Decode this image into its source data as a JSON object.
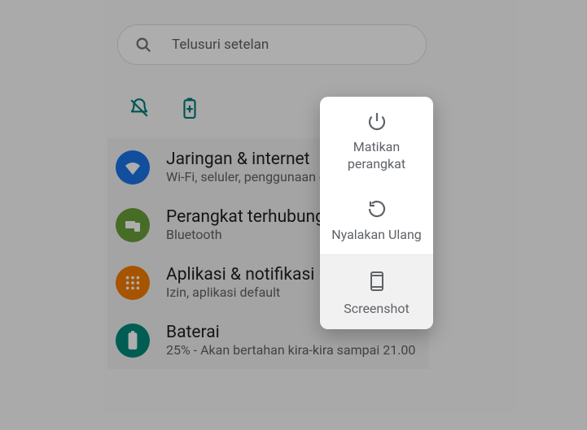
{
  "search": {
    "placeholder": "Telusuri setelan"
  },
  "settings_items": [
    {
      "title": "Jaringan & internet",
      "subtitle": "Wi-Fi, seluler, penggunaan data, dan hotspot"
    },
    {
      "title": "Perangkat terhubung",
      "subtitle": "Bluetooth"
    },
    {
      "title": "Aplikasi & notifikasi",
      "subtitle": "Izin, aplikasi default"
    },
    {
      "title": "Baterai",
      "subtitle": "25% - Akan bertahan kira-kira sampai 21.00"
    }
  ],
  "power_menu": {
    "power_off": "Matikan perangkat",
    "restart": "Nyalakan Ulang",
    "screenshot": "Screenshot"
  }
}
